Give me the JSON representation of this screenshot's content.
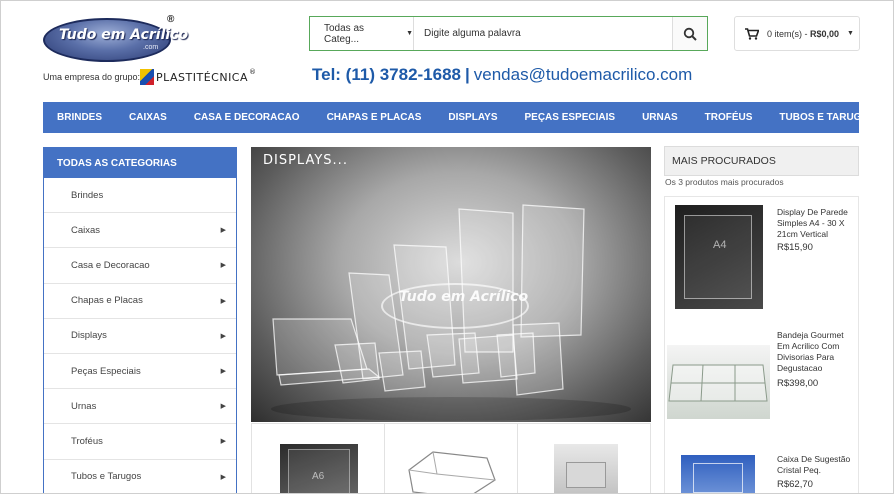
{
  "header": {
    "logo_text": "Tudo em Acrílico",
    "logo_com": ".com",
    "logo_reg": "®",
    "group_text": "Uma empresa do grupo:",
    "group_logo_text": "PLASTITÉCNICA",
    "group_logo_reg": "®",
    "search": {
      "category": "Todas as Categ...",
      "placeholder": "Digite alguma palavra"
    },
    "cart": {
      "items_text": "0 item(s) - ",
      "total": "R$0,00"
    },
    "contact": {
      "tel": "Tel: (11) 3782-1688",
      "separator": "|",
      "email": "vendas@tudoemacrilico.com"
    }
  },
  "nav": {
    "items": [
      "BRINDES",
      "CAIXAS",
      "CASA E DECORACAO",
      "CHAPAS E PLACAS",
      "DISPLAYS",
      "PEÇAS ESPECIAIS",
      "URNAS",
      "TROFÉUS",
      "TUBOS E TARUGOS"
    ]
  },
  "sidebar": {
    "title": "TODAS AS CATEGORIAS",
    "items": [
      {
        "label": "Brindes",
        "arrow": false
      },
      {
        "label": "Caixas",
        "arrow": true
      },
      {
        "label": "Casa e Decoracao",
        "arrow": true
      },
      {
        "label": "Chapas e Placas",
        "arrow": true
      },
      {
        "label": "Displays",
        "arrow": true
      },
      {
        "label": "Peças Especiais",
        "arrow": true
      },
      {
        "label": "Urnas",
        "arrow": true
      },
      {
        "label": "Troféus",
        "arrow": true
      },
      {
        "label": "Tubos e Tarugos",
        "arrow": true
      }
    ]
  },
  "banner": {
    "title": "DISPLAYS...",
    "watermark": "Tudo em Acrílico"
  },
  "thumbnails": {
    "first_label": "A6"
  },
  "most_searched": {
    "title": "MAIS PROCURADOS",
    "subtitle": "Os 3 produtos mais procurados",
    "products": [
      {
        "name": "Display De Parede Simples A4 - 30 X 21cm Vertical",
        "price": "R$15,90",
        "img_label": "A4"
      },
      {
        "name": "Bandeja Gourmet Em Acrilico Com Divisorias Para Degustacao",
        "price": "R$398,00"
      },
      {
        "name": "Caixa De Sugestão Cristal Peq.",
        "price": "R$62,70"
      }
    ]
  },
  "colors": {
    "nav_blue": "#4472c4",
    "contact_blue": "#1e5aa8",
    "search_border": "#58a85a"
  }
}
